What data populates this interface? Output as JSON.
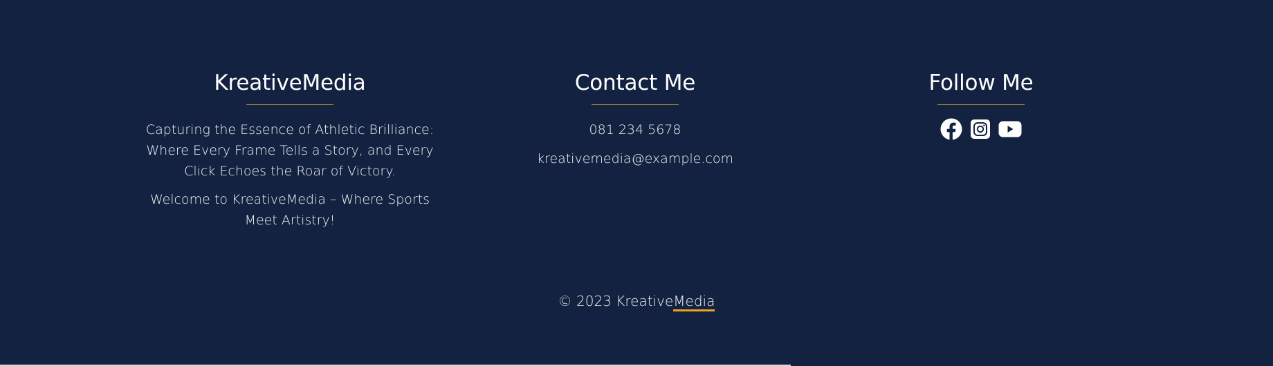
{
  "brand": {
    "heading": "KreativeMedia",
    "tagline": "Capturing the Essence of Athletic Brilliance: Where Every Frame Tells a Story, and Every Click Echoes the Roar of Victory.",
    "welcome": "Welcome to KreativeMedia – Where Sports Meet Artistry!"
  },
  "contact": {
    "heading": "Contact Me",
    "phone": "081 234 5678",
    "email": "kreativemedia@example.com"
  },
  "follow": {
    "heading": "Follow Me",
    "icons": [
      "facebook-icon",
      "instagram-icon",
      "youtube-icon"
    ]
  },
  "copyright": {
    "prefix": "© 2023 Kreative",
    "link_text": "Media"
  },
  "colors": {
    "background": "#132240",
    "divider": "#a8823a",
    "link_underline": "#f0a419",
    "text": "#ffffff"
  }
}
